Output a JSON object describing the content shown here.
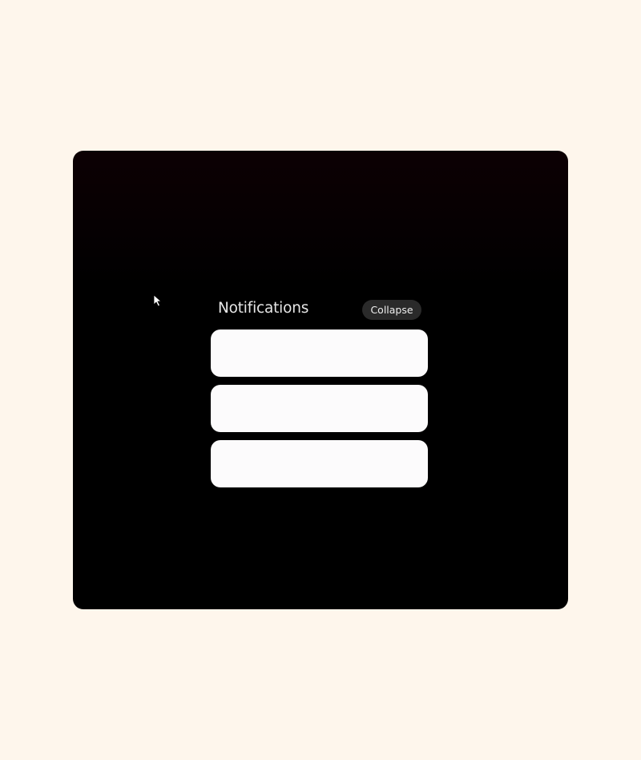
{
  "notifications": {
    "title": "Notifications",
    "collapse_label": "Collapse",
    "cards": [
      {
        "text": ""
      },
      {
        "text": ""
      },
      {
        "text": ""
      }
    ]
  },
  "icons": {
    "cursor": "mouse-pointer-icon"
  },
  "colors": {
    "page_background": "#fef6ec",
    "frame_background": "#000000",
    "card_background": "#fcfbfc",
    "button_background": "#2a2a2a"
  }
}
